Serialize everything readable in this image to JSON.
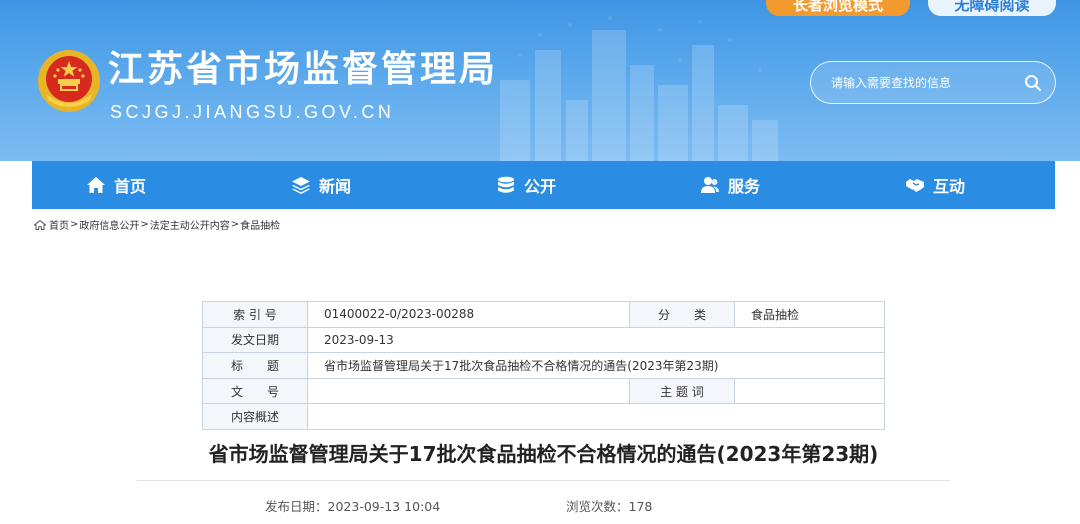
{
  "header": {
    "top_buttons": {
      "elder_mode": "长者浏览模式",
      "accessible": "无障碍阅读"
    },
    "site_title": "江苏省市场监督管理局",
    "site_domain": "SCJGJ.JIANGSU.GOV.CN",
    "search": {
      "placeholder": "请输入需要查找的信息"
    },
    "colors": {
      "banner": "#4a9de8",
      "elder_button": "#f29a2e",
      "nav": "#2a8ce2"
    }
  },
  "nav": {
    "items": [
      {
        "label": "首页",
        "icon": "home-icon"
      },
      {
        "label": "新闻",
        "icon": "layers-icon"
      },
      {
        "label": "公开",
        "icon": "stack-icon"
      },
      {
        "label": "服务",
        "icon": "people-icon"
      },
      {
        "label": "互动",
        "icon": "handshake-icon"
      }
    ]
  },
  "breadcrumb": {
    "items": [
      "首页",
      "政府信息公开",
      "法定主动公开内容",
      "食品抽检"
    ],
    "separator": ">"
  },
  "meta_table": {
    "index_label": "索 引 号",
    "index_value": "01400022-0/2023-00288",
    "category_label": "分　　类",
    "category_value": "食品抽检",
    "date_label": "发文日期",
    "date_value": "2023-09-13",
    "title_label": "标　　题",
    "title_value": "省市场监督管理局关于17批次食品抽检不合格情况的通告(2023年第23期)",
    "doc_no_label": "文　　号",
    "doc_no_value": "",
    "subject_label": "主 题 词",
    "subject_value": "",
    "summary_label": "内容概述",
    "summary_value": ""
  },
  "article": {
    "title": "省市场监督管理局关于17批次食品抽检不合格情况的通告(2023年第23期)",
    "publish_label": "发布日期：",
    "publish_value": "2023-09-13 10:04",
    "views_label": "浏览次数：",
    "views_value": "178"
  }
}
